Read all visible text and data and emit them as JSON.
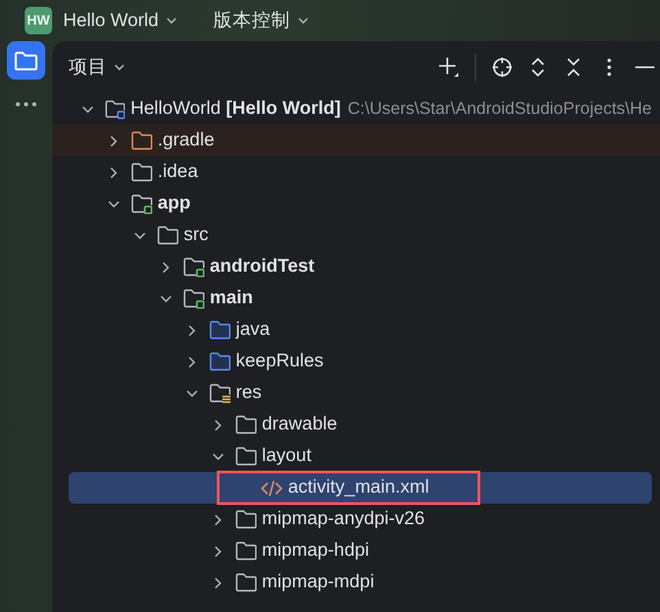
{
  "title_bar": {
    "app_badge": "HW",
    "project": "Hello World",
    "vcs": "版本控制"
  },
  "panel": {
    "title": "项目"
  },
  "tree": [
    {
      "label": "HelloWorld **[Hello World]**",
      "path": "C:\\Users\\Star\\AndroidStudioProjects\\He",
      "kind": "project",
      "expanded": true,
      "selected": false,
      "children": [
        {
          "label": ".gradle",
          "kind": "excluded",
          "expanded": false,
          "selected": false
        },
        {
          "label": ".idea",
          "kind": "folder",
          "expanded": false,
          "selected": false
        },
        {
          "label": "app",
          "kind": "module",
          "expanded": true,
          "selected": false,
          "children": [
            {
              "label": "src",
              "kind": "folder",
              "expanded": true,
              "selected": false,
              "children": [
                {
                  "label": "androidTest",
                  "kind": "module",
                  "expanded": false,
                  "selected": false
                },
                {
                  "label": "main",
                  "kind": "module",
                  "expanded": true,
                  "selected": false,
                  "children": [
                    {
                      "label": "java",
                      "kind": "source",
                      "expanded": false,
                      "selected": false
                    },
                    {
                      "label": "keepRules",
                      "kind": "source",
                      "expanded": false,
                      "selected": false
                    },
                    {
                      "label": "res",
                      "kind": "resources",
                      "expanded": true,
                      "selected": false,
                      "children": [
                        {
                          "label": "drawable",
                          "kind": "folder",
                          "expanded": false,
                          "selected": false
                        },
                        {
                          "label": "layout",
                          "kind": "folder",
                          "expanded": true,
                          "selected": false,
                          "children": [
                            {
                              "label": "activity_main.xml",
                              "kind": "xml",
                              "selected": true,
                              "annotated": true
                            }
                          ]
                        },
                        {
                          "label": "mipmap-anydpi-v26",
                          "kind": "folder",
                          "expanded": false,
                          "selected": false
                        },
                        {
                          "label": "mipmap-hdpi",
                          "kind": "folder",
                          "expanded": false,
                          "selected": false
                        },
                        {
                          "label": "mipmap-mdpi",
                          "kind": "folder",
                          "expanded": false,
                          "selected": false
                        }
                      ]
                    }
                  ]
                }
              ]
            }
          ]
        }
      ]
    }
  ]
}
